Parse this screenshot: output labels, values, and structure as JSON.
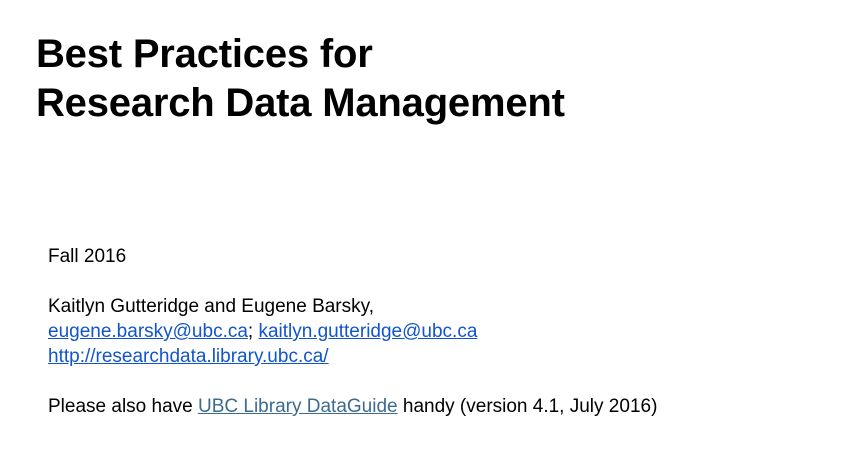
{
  "title": {
    "line1": "Best Practices for",
    "line2": "Research Data Management"
  },
  "body": {
    "term": "Fall 2016",
    "authors": "Kaitlyn Gutteridge and Eugene Barsky,",
    "email1": "eugene.barsky@ubc.ca",
    "email_separator": ";",
    "email2": "kaitlyn.gutteridge@ubc.ca",
    "website": "http://researchdata.library.ubc.ca/",
    "note_prefix": "Please also have ",
    "note_link": "UBC Library DataGuide",
    "note_suffix": " handy (version 4.1, July 2016)"
  },
  "colors": {
    "link": "#1155cc",
    "guide_link": "#3d6b8e",
    "text": "#000000",
    "background": "#ffffff"
  }
}
